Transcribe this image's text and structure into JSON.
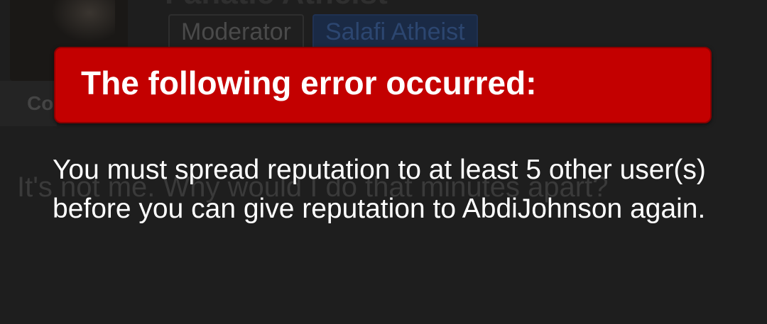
{
  "post": {
    "username": "Fanatic Atheist",
    "badges": [
      "Moderator",
      "Salafi Atheist"
    ],
    "stats_label": "Co",
    "body": "It's not me. Why would I do that minutes apart?"
  },
  "error": {
    "title": "The following error occurred:",
    "message": "You must spread reputation to at least 5 other user(s) before you can give reputation to AbdiJohnson again."
  },
  "colors": {
    "banner": "#c30000",
    "background": "#1e1e1e",
    "text": "#ffffff"
  }
}
